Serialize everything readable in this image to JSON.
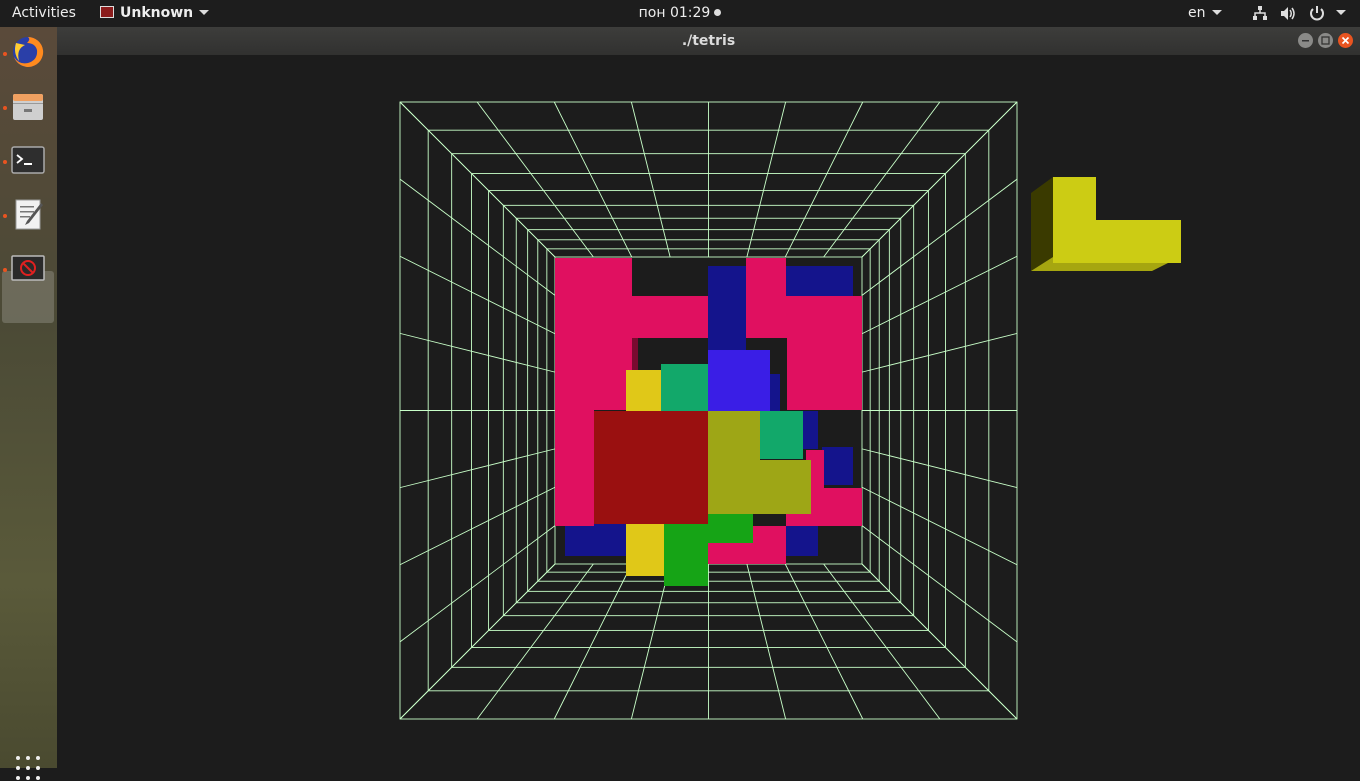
{
  "topbar": {
    "activities": "Activities",
    "app_name": "Unknown",
    "clock": "пон 01:29",
    "language": "en"
  },
  "dock": {
    "items": [
      {
        "name": "firefox",
        "icon": "firefox-icon",
        "running": true
      },
      {
        "name": "files",
        "icon": "files-icon",
        "running": true
      },
      {
        "name": "terminal",
        "icon": "terminal-icon",
        "running": true
      },
      {
        "name": "text-editor",
        "icon": "text-editor-icon",
        "running": true
      },
      {
        "name": "unknown-app",
        "icon": "no-entry-icon",
        "running": true,
        "active": true
      }
    ],
    "show_apps": "grid-icon"
  },
  "window": {
    "title": "./tetris"
  },
  "colors": {
    "grid": "#c8ffc8",
    "magenta": "#e01060",
    "navy": "#14148c",
    "blue": "#3a1ee6",
    "yellow": "#e0c818",
    "teal": "#12a86a",
    "red": "#9a1010",
    "olive": "#9ea616",
    "green": "#16a416",
    "next_piece": "#cccc14",
    "next_piece_dark": "#3a3a00",
    "accent": "#e95420"
  }
}
